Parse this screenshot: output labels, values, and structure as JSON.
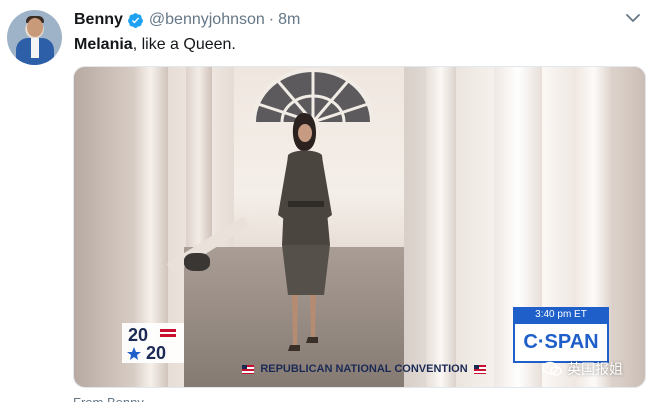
{
  "tweet": {
    "name": "Benny",
    "handle": "@bennyjohnson",
    "separator": "·",
    "time": "8m",
    "text_bold": "Melania",
    "text_rest": ", like a Queen."
  },
  "media": {
    "logo_top": "20",
    "logo_bottom": "20",
    "cspan_time": "3:40 pm ET",
    "cspan_label": "C·SPAN",
    "banner": "REPUBLICAN NATIONAL CONVENTION",
    "watermark": "英国报姐"
  },
  "bottom": {
    "partial_text": "From Benny"
  },
  "icons": {
    "verified": "verified-badge-icon",
    "caret": "chevron-down-icon",
    "watermark": "wechat-icon"
  },
  "colors": {
    "verified": "#1da1f2",
    "secondary_text": "#657786",
    "cspan_blue": "#1e5fc9"
  }
}
